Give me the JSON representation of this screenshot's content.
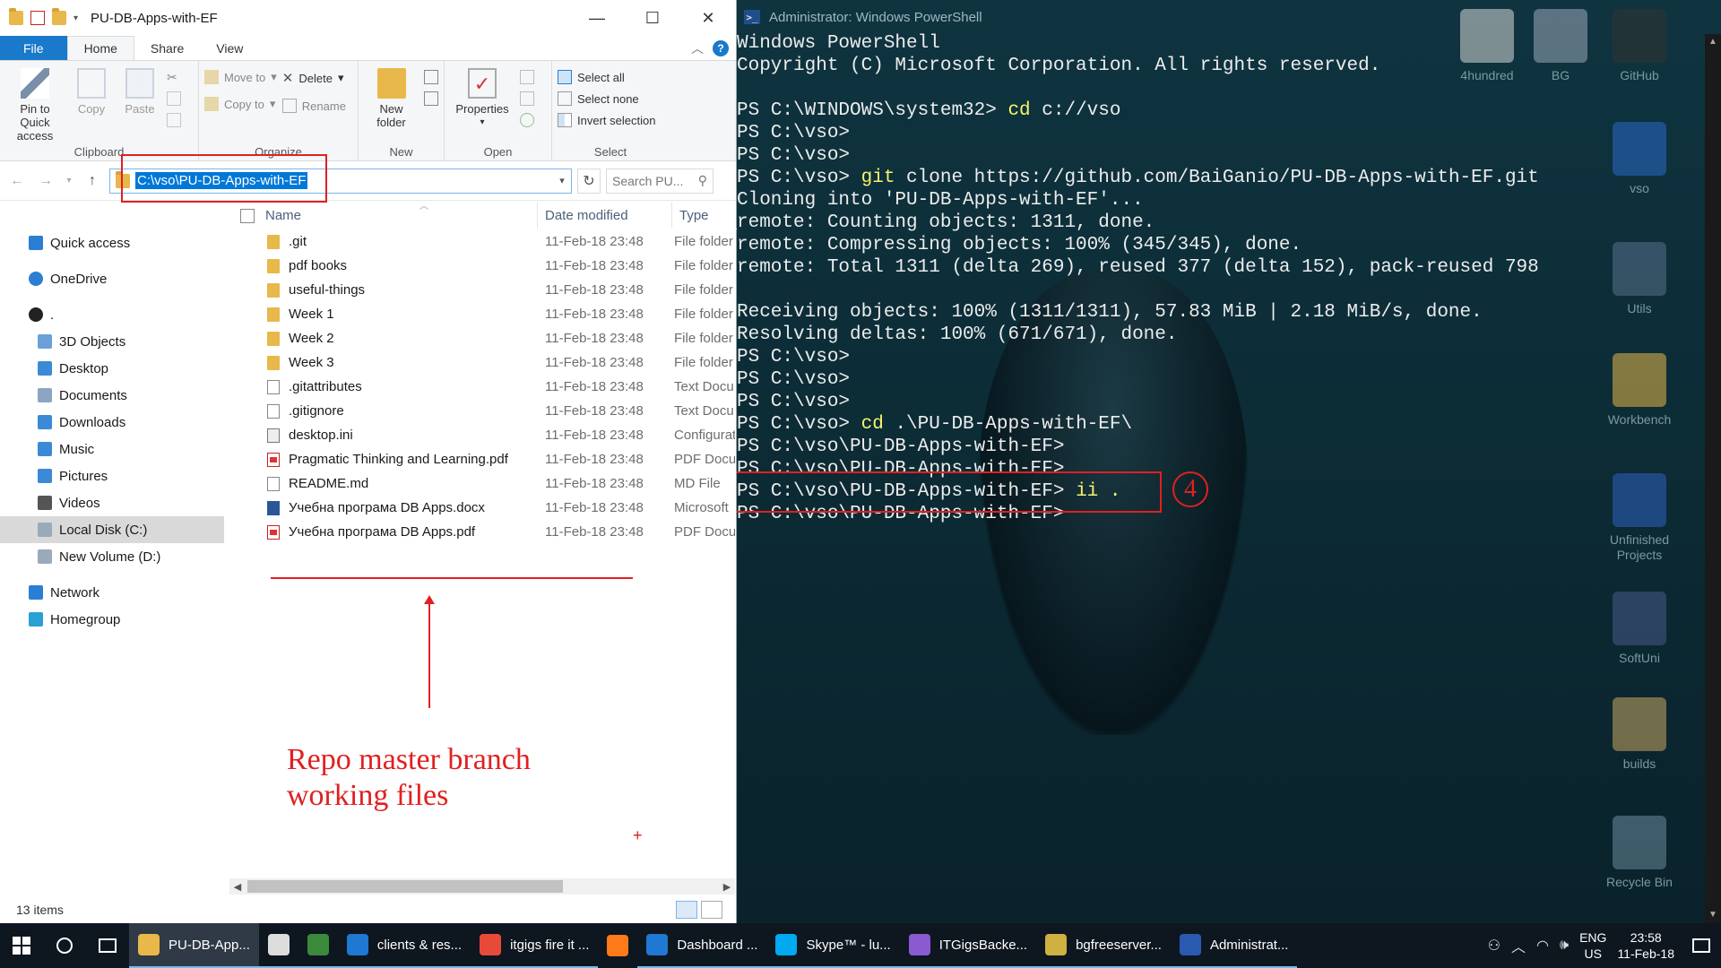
{
  "explorer": {
    "title": "PU-DB-Apps-with-EF",
    "tabs": [
      "File",
      "Home",
      "Share",
      "View"
    ],
    "ribbon": {
      "clipboard": {
        "label": "Clipboard",
        "pin": "Pin to Quick access",
        "copy": "Copy",
        "paste": "Paste"
      },
      "organize": {
        "label": "Organize",
        "move_to": "Move to",
        "copy_to": "Copy to",
        "delete": "Delete",
        "rename": "Rename"
      },
      "new": {
        "label": "New",
        "new_folder": "New folder"
      },
      "open": {
        "label": "Open",
        "properties": "Properties"
      },
      "select": {
        "label": "Select",
        "select_all": "Select all",
        "select_none": "Select none",
        "invert": "Invert selection"
      }
    },
    "address": "C:\\vso\\PU-DB-Apps-with-EF",
    "search_placeholder": "Search PU...",
    "sidebar": [
      {
        "label": "Quick access",
        "icon": "star-icon",
        "color": "#2a7fd4",
        "sub": false
      },
      {
        "label": "OneDrive",
        "icon": "cloud-icon",
        "color": "#2a7fd4",
        "sub": false
      },
      {
        "label": ".",
        "icon": "user-icon",
        "color": "#222",
        "sub": false
      },
      {
        "label": "3D Objects",
        "icon": "folder-icon",
        "color": "#6aa0d8",
        "sub": true
      },
      {
        "label": "Desktop",
        "icon": "folder-icon",
        "color": "#3a8ad6",
        "sub": true
      },
      {
        "label": "Documents",
        "icon": "folder-icon",
        "color": "#8ba5c2",
        "sub": true
      },
      {
        "label": "Downloads",
        "icon": "folder-icon",
        "color": "#3a8ad6",
        "sub": true
      },
      {
        "label": "Music",
        "icon": "folder-icon",
        "color": "#3a8ad6",
        "sub": true
      },
      {
        "label": "Pictures",
        "icon": "folder-icon",
        "color": "#3a8ad6",
        "sub": true
      },
      {
        "label": "Videos",
        "icon": "folder-icon",
        "color": "#555",
        "sub": true
      },
      {
        "label": "Local Disk (C:)",
        "icon": "drive-icon",
        "color": "#9ab",
        "sub": true,
        "selected": true
      },
      {
        "label": "New Volume (D:)",
        "icon": "drive-icon",
        "color": "#9ab",
        "sub": true
      },
      {
        "label": "Network",
        "icon": "network-icon",
        "color": "#2a7fd4",
        "sub": false
      },
      {
        "label": "Homegroup",
        "icon": "homegroup-icon",
        "color": "#2a9fd4",
        "sub": false
      }
    ],
    "columns": {
      "name": "Name",
      "date": "Date modified",
      "type": "Type"
    },
    "files": [
      {
        "name": ".git",
        "date": "11-Feb-18 23:48",
        "type": "File folder",
        "kind": "folder"
      },
      {
        "name": "pdf books",
        "date": "11-Feb-18 23:48",
        "type": "File folder",
        "kind": "folder"
      },
      {
        "name": "useful-things",
        "date": "11-Feb-18 23:48",
        "type": "File folder",
        "kind": "folder"
      },
      {
        "name": "Week 1",
        "date": "11-Feb-18 23:48",
        "type": "File folder",
        "kind": "folder"
      },
      {
        "name": "Week 2",
        "date": "11-Feb-18 23:48",
        "type": "File folder",
        "kind": "folder"
      },
      {
        "name": "Week 3",
        "date": "11-Feb-18 23:48",
        "type": "File folder",
        "kind": "folder"
      },
      {
        "name": ".gitattributes",
        "date": "11-Feb-18 23:48",
        "type": "Text Docu",
        "kind": "doc"
      },
      {
        "name": ".gitignore",
        "date": "11-Feb-18 23:48",
        "type": "Text Docu",
        "kind": "doc"
      },
      {
        "name": "desktop.ini",
        "date": "11-Feb-18 23:48",
        "type": "Configurat",
        "kind": "ini"
      },
      {
        "name": "Pragmatic Thinking and Learning.pdf",
        "date": "11-Feb-18 23:48",
        "type": "PDF Docu",
        "kind": "pdf"
      },
      {
        "name": "README.md",
        "date": "11-Feb-18 23:48",
        "type": "MD File",
        "kind": "doc"
      },
      {
        "name": "Учебна програма DB Apps.docx",
        "date": "11-Feb-18 23:48",
        "type": "Microsoft",
        "kind": "word"
      },
      {
        "name": "Учебна програма DB Apps.pdf",
        "date": "11-Feb-18 23:48",
        "type": "PDF Docu",
        "kind": "pdf"
      }
    ],
    "annotation": [
      "Repo master branch",
      "working files"
    ],
    "annotation_plus": "+",
    "status": "13 items"
  },
  "powershell": {
    "title": "Administrator: Windows PowerShell",
    "lines": [
      [
        {
          "t": "Windows PowerShell"
        }
      ],
      [
        {
          "t": "Copyright (C) Microsoft Corporation. All rights reserved."
        }
      ],
      [
        {
          "t": ""
        }
      ],
      [
        {
          "t": "PS C:\\WINDOWS\\system32> "
        },
        {
          "t": "cd",
          "k": true
        },
        {
          "t": " c://vso"
        }
      ],
      [
        {
          "t": "PS C:\\vso>"
        }
      ],
      [
        {
          "t": "PS C:\\vso>"
        }
      ],
      [
        {
          "t": "PS C:\\vso> "
        },
        {
          "t": "git",
          "k": true
        },
        {
          "t": " clone https://github.com/BaiGanio/PU-DB-Apps-with-EF.git"
        }
      ],
      [
        {
          "t": "Cloning into 'PU-DB-Apps-with-EF'..."
        }
      ],
      [
        {
          "t": "remote: Counting objects: 1311, done."
        }
      ],
      [
        {
          "t": "remote: Compressing objects: 100% (345/345), done."
        }
      ],
      [
        {
          "t": "remote: Total 1311 (delta 269), reused 377 (delta 152), pack-reused 798"
        }
      ],
      [
        {
          "t": ""
        }
      ],
      [
        {
          "t": "Receiving objects: 100% (1311/1311), 57.83 MiB | 2.18 MiB/s, done."
        }
      ],
      [
        {
          "t": "Resolving deltas: 100% (671/671), done."
        }
      ],
      [
        {
          "t": "PS C:\\vso>"
        }
      ],
      [
        {
          "t": "PS C:\\vso>"
        }
      ],
      [
        {
          "t": "PS C:\\vso>"
        }
      ],
      [
        {
          "t": "PS C:\\vso> "
        },
        {
          "t": "cd",
          "k": true
        },
        {
          "t": " .\\PU-DB-Apps-with-EF\\"
        }
      ],
      [
        {
          "t": "PS C:\\vso\\PU-DB-Apps-with-EF>"
        }
      ],
      [
        {
          "t": "PS C:\\vso\\PU-DB-Apps-with-EF>"
        }
      ],
      [
        {
          "t": "PS C:\\vso\\PU-DB-Apps-with-EF> "
        },
        {
          "t": "ii .",
          "k": true
        }
      ],
      [
        {
          "t": "PS C:\\vso\\PU-DB-Apps-with-EF>"
        }
      ]
    ],
    "step_number": "4"
  },
  "desktop_icons": [
    {
      "label": "4hundred",
      "color": "#d8d8d8"
    },
    {
      "label": "BG",
      "color": "#9aa8b8"
    },
    {
      "label": "GitHub",
      "color": "#333"
    },
    {
      "label": "vso",
      "color": "#2a68c8"
    },
    {
      "label": "Utils",
      "color": "#5a6f8a"
    },
    {
      "label": "Workbench",
      "color": "#e8b84a"
    },
    {
      "label": "Unfinished Projects",
      "color": "#3060c0"
    },
    {
      "label": "SoftUni",
      "color": "#4a5a8a"
    },
    {
      "label": "builds",
      "color": "#c8a860"
    },
    {
      "label": "Recycle Bin",
      "color": "#6a8a9a"
    }
  ],
  "taskbar": {
    "items": [
      {
        "label": "PU-DB-App...",
        "color": "#e8b84a",
        "active": true,
        "underline": true
      },
      {
        "label": "",
        "color": "#ddd",
        "active": false,
        "underline": true
      },
      {
        "label": "",
        "color": "#3b8a3b",
        "active": false,
        "underline": true
      },
      {
        "label": "clients & res...",
        "color": "#1f78d1",
        "active": false,
        "underline": true
      },
      {
        "label": "itgigs fire it ...",
        "color": "#e84a3a",
        "active": false,
        "underline": true
      },
      {
        "label": "",
        "color": "#ff7a1a",
        "active": false,
        "underline": false
      },
      {
        "label": "Dashboard ...",
        "color": "#1f78d1",
        "active": false,
        "underline": true
      },
      {
        "label": "Skype™ - lu...",
        "color": "#00a9f0",
        "active": false,
        "underline": true
      },
      {
        "label": "ITGigsBacke...",
        "color": "#8a5ad0",
        "active": false,
        "underline": true
      },
      {
        "label": "bgfreeserver...",
        "color": "#d0b040",
        "active": false,
        "underline": true
      },
      {
        "label": "Administrat...",
        "color": "#2a5ab0",
        "active": false,
        "underline": true
      }
    ],
    "lang_top": "ENG",
    "lang_bottom": "US",
    "time": "23:58",
    "date": "11-Feb-18"
  }
}
